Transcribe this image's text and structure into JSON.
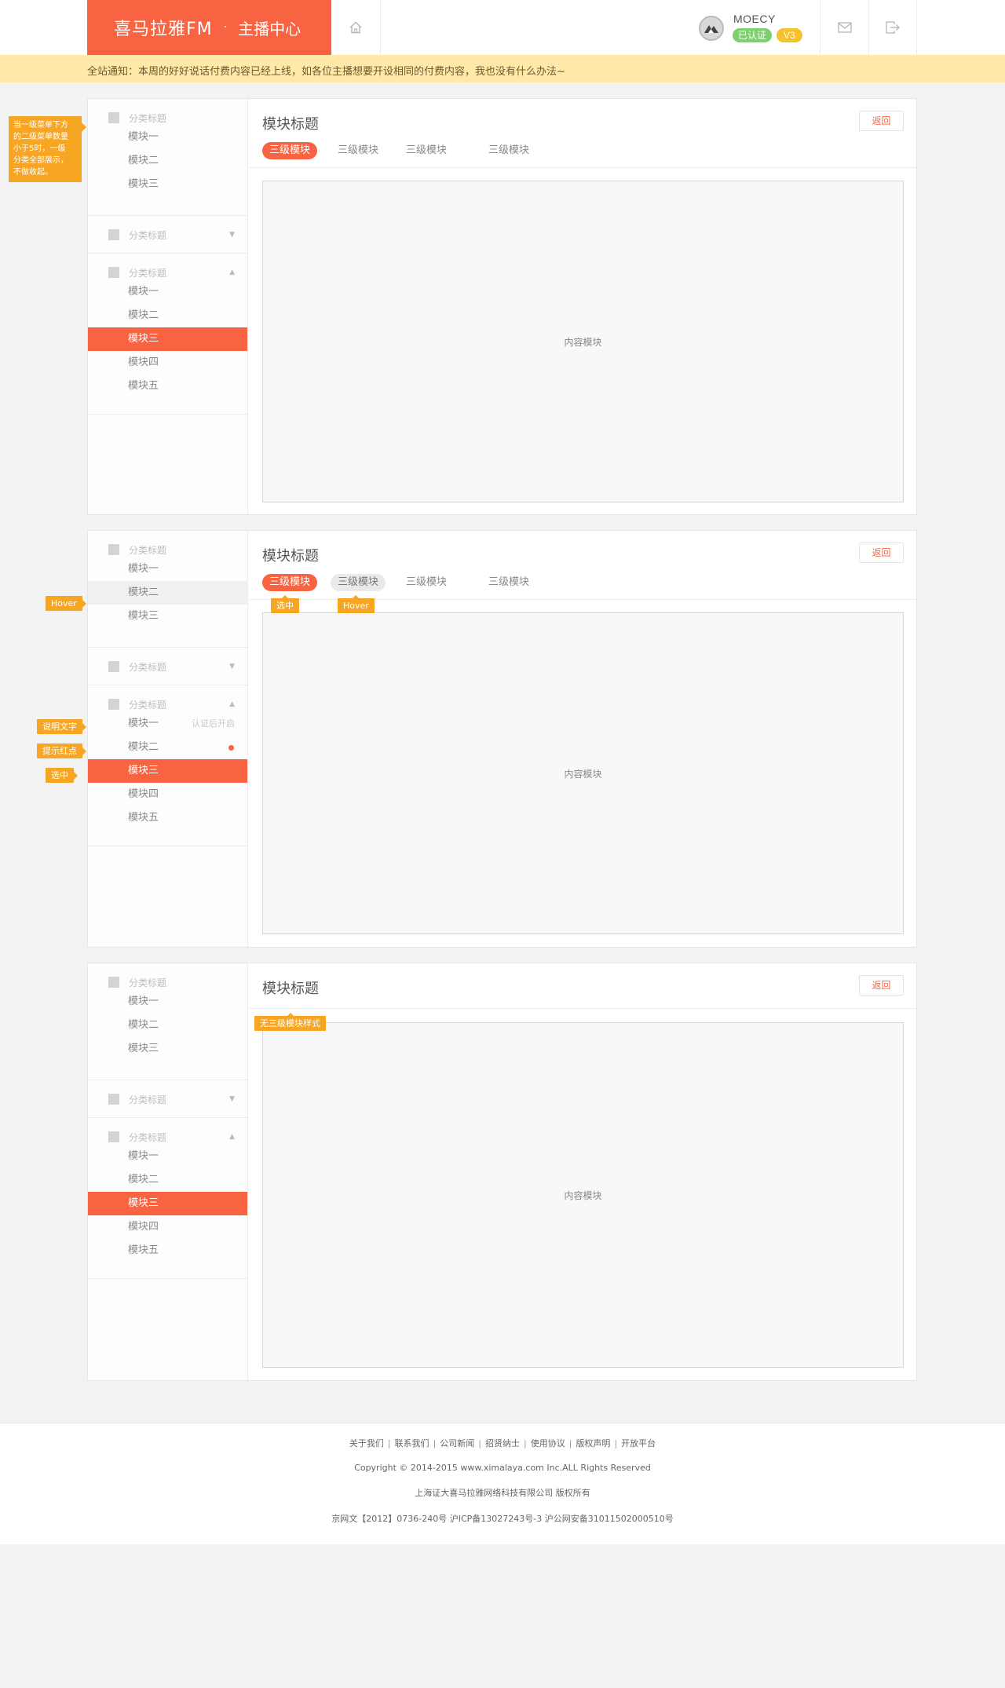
{
  "header": {
    "logo": "喜马拉雅FM",
    "dot": "·",
    "section": "主播中心",
    "user": {
      "name": "MOECY",
      "verified": "已认证",
      "level": "V3"
    },
    "icons": {
      "home": "home-icon",
      "mail": "mail-icon",
      "exit": "exit-icon"
    }
  },
  "notice": "全站通知：本周的好好说话付费内容已经上线，如各位主播想要开设相同的付费内容，我也没有什么办法~",
  "colors": {
    "accent": "#f86442",
    "annotation": "#f6a623",
    "verified": "#7dd06e",
    "level": "#f6c12a",
    "notice_bg": "#ffe8a8"
  },
  "panels": [
    {
      "sidebar": {
        "groups": [
          {
            "title": "分类标题",
            "caret": "",
            "items": [
              "模块一",
              "模块二",
              "模块三"
            ]
          },
          {
            "title": "分类标题",
            "caret": "▼",
            "items": []
          },
          {
            "title": "分类标题",
            "caret": "▲",
            "items": [
              "模块一",
              "模块二",
              "模块三",
              "模块四",
              "模块五"
            ]
          }
        ]
      },
      "title": "模块标题",
      "back": "返回",
      "tabs": [
        "三级模块",
        "三级模块",
        "三级模块",
        "三级模块"
      ],
      "content": "内容模块"
    },
    {
      "sidebar": {
        "groups": [
          {
            "title": "分类标题",
            "caret": "",
            "items": [
              "模块一",
              "模块二",
              "模块三"
            ]
          },
          {
            "title": "分类标题",
            "caret": "▼",
            "items": []
          },
          {
            "title": "分类标题",
            "caret": "▲",
            "items": [
              "模块一",
              "模块二",
              "模块三",
              "模块四",
              "模块五"
            ]
          }
        ],
        "item_note": "认证后开启"
      },
      "title": "模块标题",
      "back": "返回",
      "tabs": [
        "三级模块",
        "三级模块",
        "三级模块",
        "三级模块"
      ],
      "content": "内容模块"
    },
    {
      "sidebar": {
        "groups": [
          {
            "title": "分类标题",
            "caret": "",
            "items": [
              "模块一",
              "模块二",
              "模块三"
            ]
          },
          {
            "title": "分类标题",
            "caret": "▼",
            "items": []
          },
          {
            "title": "分类标题",
            "caret": "▲",
            "items": [
              "模块一",
              "模块二",
              "模块三",
              "模块四",
              "模块五"
            ]
          }
        ]
      },
      "title": "模块标题",
      "back": "返回",
      "content": "内容模块"
    }
  ],
  "annotations": {
    "submenu_rule": "当一级菜单下方\n的二级菜单数量\n小于5时，一级\n分类全部展示，\n不做收起。",
    "hover": "Hover",
    "desc_text": "说明文字",
    "red_dot": "提示红点",
    "selected": "选中",
    "tab_selected": "选中",
    "tab_hover": "Hover",
    "no_tabs": "无三级模块样式"
  },
  "footer": {
    "links": [
      "关于我们",
      "联系我们",
      "公司新闻",
      "招贤纳士",
      "使用协议",
      "版权声明",
      "开放平台"
    ],
    "separator": "|",
    "copyright": "Copyright © 2014-2015 www.ximalaya.com Inc.ALL Rights Reserved",
    "company": "上海证大喜马拉雅网络科技有限公司 版权所有",
    "license": "京网文【2012】0736-240号 沪ICP备13027243号-3 沪公网安备31011502000510号"
  }
}
